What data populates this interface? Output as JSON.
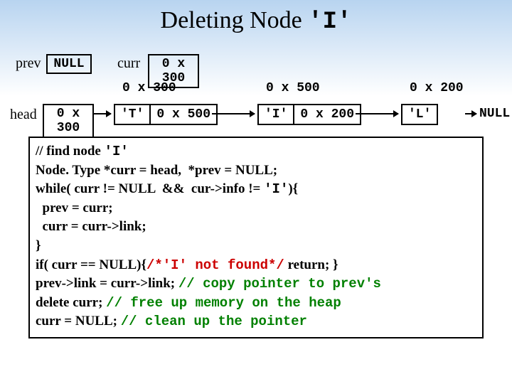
{
  "title": {
    "prefix": "Deleting Node ",
    "mono": "'I'"
  },
  "pointers": {
    "prev_label": "prev",
    "prev_value": "NULL",
    "curr_label": "curr",
    "curr_value": "0 x 300"
  },
  "addresses": {
    "a300": "0 x 300",
    "a500": "0 x 500",
    "a200": "0 x 200"
  },
  "head": {
    "label": "head",
    "value": "0 x 300"
  },
  "nodes": {
    "t": {
      "info": "'T'",
      "link": "0 x 500"
    },
    "i": {
      "info": "'I'",
      "link": "0 x 200"
    },
    "l": {
      "info": "'L'",
      "link": "NULL"
    }
  },
  "null_tail": "NULL",
  "code": {
    "l1a": "// find node ",
    "l1b": "'I'",
    "l2": "Node. Type *curr = head,  *prev = NULL;",
    "l3a": "while( curr != NULL  &&  cur->info != ",
    "l3b": "'I'",
    "l3c": "){",
    "l4": "  prev = curr;",
    "l5": "  curr = curr->link;",
    "l6": "}",
    "l7a": "if( curr == NULL){",
    "l7b": "/*'I' not found*/",
    "l7c": " return; }",
    "l8a": "prev->link = curr->link; ",
    "l8b": "// copy pointer to prev's",
    "l9a": "delete curr; ",
    "l9b": "// free up memory on the heap",
    "l10a": "curr = NULL; ",
    "l10b": "// clean up the pointer"
  }
}
